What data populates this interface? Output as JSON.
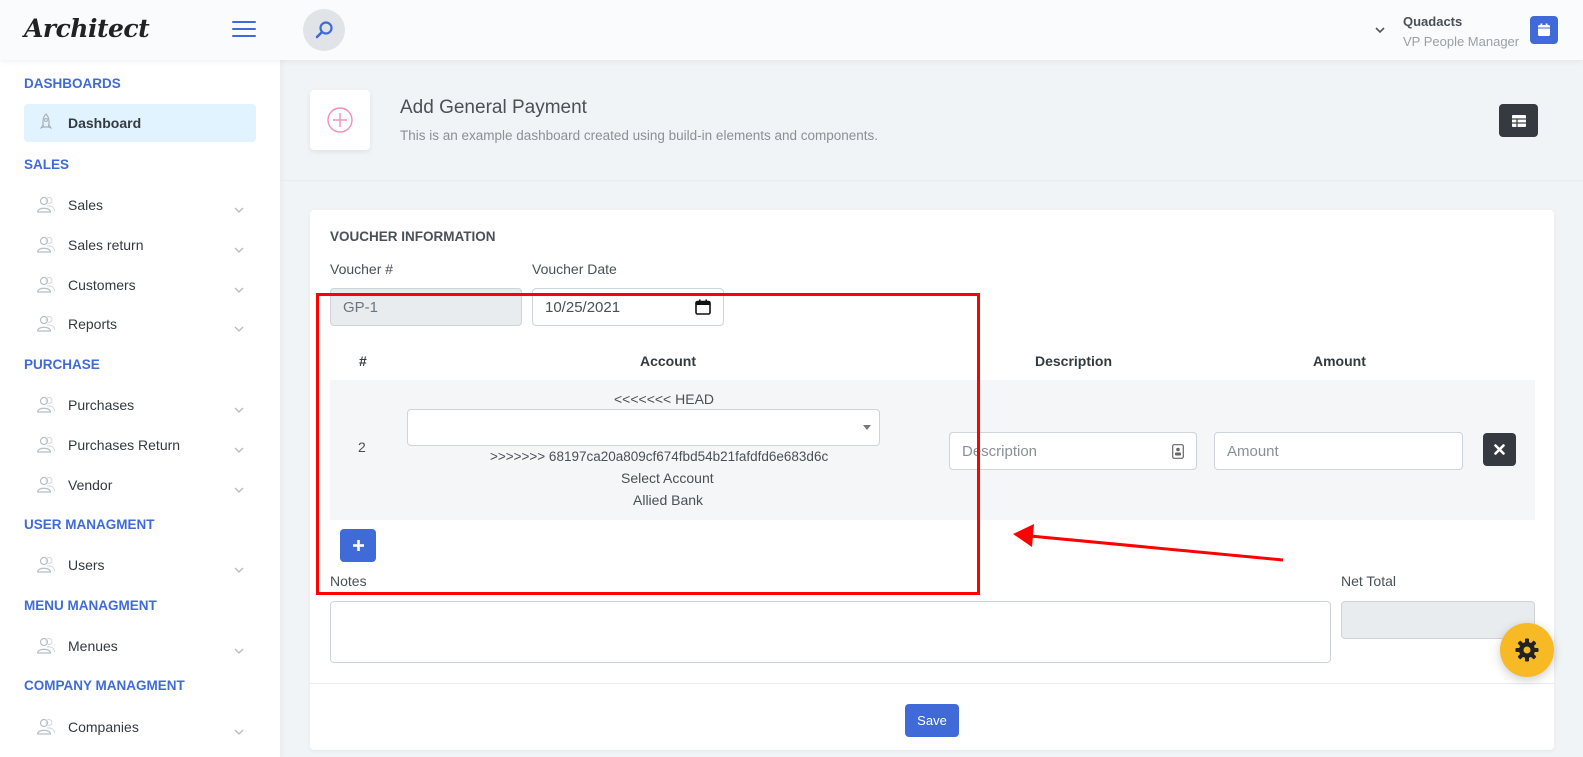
{
  "header": {
    "logo": "Architect",
    "user": {
      "name": "Quadacts",
      "role": "VP People Manager"
    }
  },
  "sidebar": {
    "sections": [
      {
        "heading": "DASHBOARDS",
        "items": [
          {
            "label": "Dashboard",
            "active": true,
            "icon": "rocket-icon"
          }
        ]
      },
      {
        "heading": "SALES",
        "items": [
          {
            "label": "Sales"
          },
          {
            "label": "Sales return"
          },
          {
            "label": "Customers"
          },
          {
            "label": "Reports"
          }
        ]
      },
      {
        "heading": "PURCHASE",
        "items": [
          {
            "label": "Purchases"
          },
          {
            "label": "Purchases Return"
          },
          {
            "label": "Vendor"
          }
        ]
      },
      {
        "heading": "USER MANAGMENT",
        "items": [
          {
            "label": "Users"
          }
        ]
      },
      {
        "heading": "MENU MANAGMENT",
        "items": [
          {
            "label": "Menues"
          }
        ]
      },
      {
        "heading": "COMPANY MANAGMENT",
        "items": [
          {
            "label": "Companies"
          }
        ]
      }
    ]
  },
  "page": {
    "title": "Add General Payment",
    "subtitle": "This is an example dashboard created using build-in elements and components."
  },
  "voucher": {
    "section_title": "VOUCHER INFORMATION",
    "number_label": "Voucher #",
    "number_value": "GP-1",
    "date_label": "Voucher Date",
    "date_value": "10/25/2021"
  },
  "table": {
    "headers": {
      "index": "#",
      "account": "Account",
      "description": "Description",
      "amount": "Amount"
    },
    "row": {
      "index": "2",
      "conflict_head": "<<<<<<< HEAD",
      "conflict_hash": ">>>>>>> 68197ca20a809cf674fbd54b21fafdfd6e683d6c",
      "select_account": "Select Account",
      "account_option": "Allied Bank",
      "description_placeholder": "Description",
      "amount_placeholder": "Amount"
    }
  },
  "notes_label": "Notes",
  "net_total_label": "Net Total",
  "save_label": "Save",
  "colors": {
    "accent": "#3f6ad8",
    "dark": "#343a40",
    "annotation": "#ff0000",
    "fab": "#f7b924"
  }
}
